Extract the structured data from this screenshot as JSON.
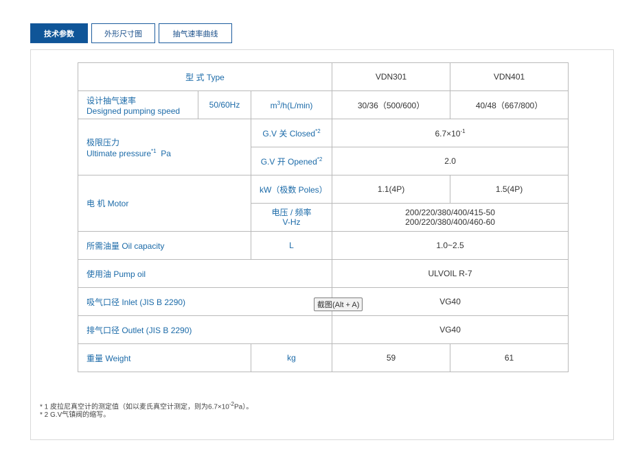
{
  "tabs": [
    {
      "label": "技术参数",
      "active": true
    },
    {
      "label": "外形尺寸图",
      "active": false
    },
    {
      "label": "抽气速率曲线",
      "active": false
    }
  ],
  "table": {
    "type_header": "型 式 Type",
    "models": [
      "VDN301",
      "VDN401"
    ],
    "speed": {
      "cn": "设计抽气速率",
      "en": "Designed pumping speed",
      "freq": "50/60Hz",
      "unit_pre": "m",
      "unit_sup": "3",
      "unit_post": "/h(L/min)",
      "values": [
        "30/36（500/600）",
        "40/48（667/800）"
      ]
    },
    "ultimate": {
      "cn": "极限压力",
      "en": "Ultimate pressure",
      "en_sup": "*1",
      "en_unit": "Pa",
      "closed": "G.V 关 Closed",
      "closed_sup": "*2",
      "closed_value_base": "6.7×10",
      "closed_value_exp": "-1",
      "opened": "G.V 开 Opened",
      "opened_sup": "*2",
      "opened_value": "2.0"
    },
    "motor": {
      "label": "电 机 Motor",
      "power_unit": "kW（极数 Poles）",
      "power_values": [
        "1.1(4P)",
        "1.5(4P)"
      ],
      "volt_unit_1": "电压 / 频率",
      "volt_unit_2": "V-Hz",
      "volt_line1": "200/220/380/400/415-50",
      "volt_line2": "200/220/380/400/460-60"
    },
    "oil_capacity": {
      "label": "所需油量 Oil capacity",
      "unit": "L",
      "value": "1.0~2.5"
    },
    "pump_oil": {
      "label": "使用油 Pump oil",
      "value": "ULVOIL  R-7"
    },
    "inlet": {
      "label": "吸气口径 Inlet (JIS B 2290)",
      "value": "VG40"
    },
    "outlet": {
      "label": "排气口径 Outlet (JIS B 2290)",
      "value": "VG40"
    },
    "weight": {
      "label": "重量 Weight",
      "unit": "kg",
      "values": [
        "59",
        "61"
      ]
    }
  },
  "tooltip": "截图(Alt + A)",
  "notes": {
    "n1_pre": "* 1  皮拉尼真空计的测定值（如以麦氏真空计测定，则为6.7×10",
    "n1_exp": "-2",
    "n1_post": "Pa）。",
    "n2": "* 2  G.V气镇阀的缩写。"
  }
}
